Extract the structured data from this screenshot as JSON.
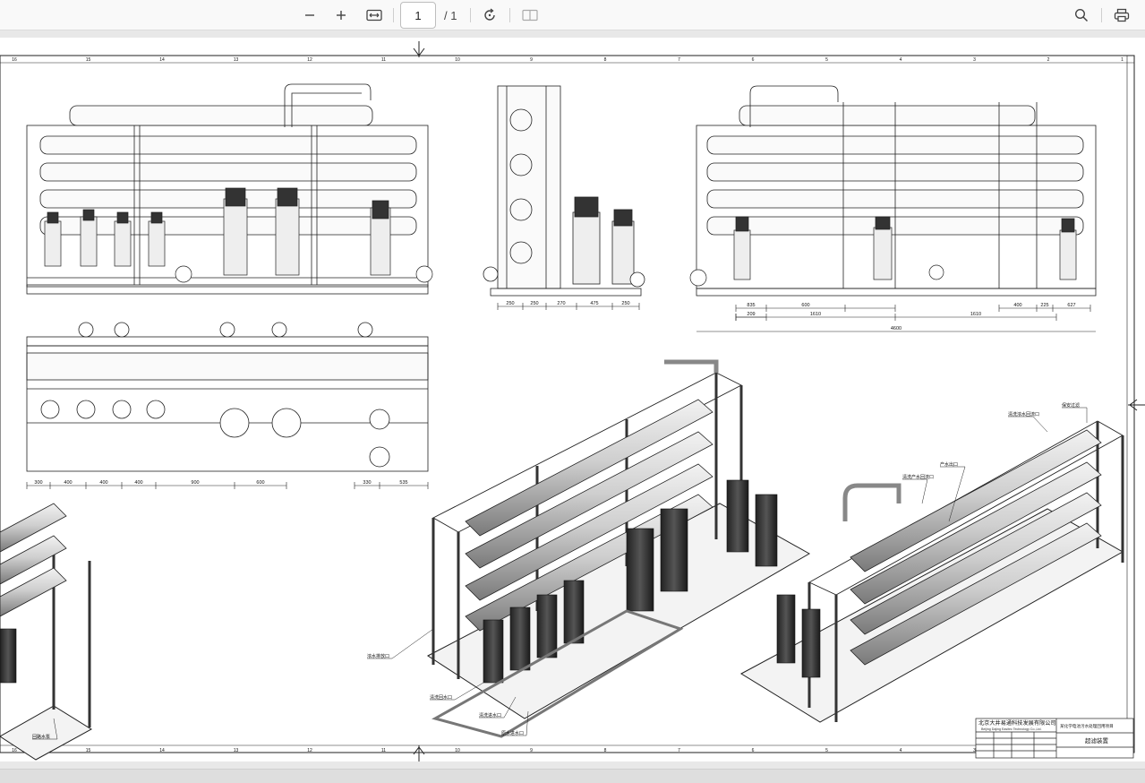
{
  "toolbar": {
    "zoom_out_icon": "minus-icon",
    "zoom_in_icon": "plus-icon",
    "fit_width_icon": "fit-width-icon",
    "page_current": "1",
    "page_total": "/ 1",
    "rotate_icon": "rotate-icon",
    "two_page_icon": "two-page-icon",
    "search_icon": "search-icon",
    "print_icon": "print-icon"
  },
  "drawing": {
    "dims_front": [
      "250",
      "250",
      "270",
      "475",
      "250"
    ],
    "dims_right": [
      "835",
      "600",
      "1610",
      "1610",
      "400",
      "225",
      "627",
      "209"
    ],
    "dim_total": "4600",
    "dims_plan": [
      "300",
      "400",
      "400",
      "400",
      "900",
      "600",
      "330",
      "535"
    ],
    "callouts": [
      "浓水排放口",
      "清洗回水口",
      "清洗进水口",
      "原水进水口",
      "产水出口",
      "清洗产水回流口",
      "清洗浓水回流口",
      "保安过滤",
      "回路水泵"
    ],
    "ruler_numbers": [
      "16",
      "15",
      "14",
      "13",
      "12",
      "11",
      "10",
      "9",
      "8",
      "7",
      "6",
      "5",
      "4",
      "3",
      "2",
      "1"
    ],
    "title_block": {
      "company": "北京大井易通科技发展有限公司",
      "company_en": "Beijing Dajing Easitec Technology Co.,Ltd.",
      "project": "某化学电池污水处理回用项目",
      "name": "超滤装置"
    }
  }
}
